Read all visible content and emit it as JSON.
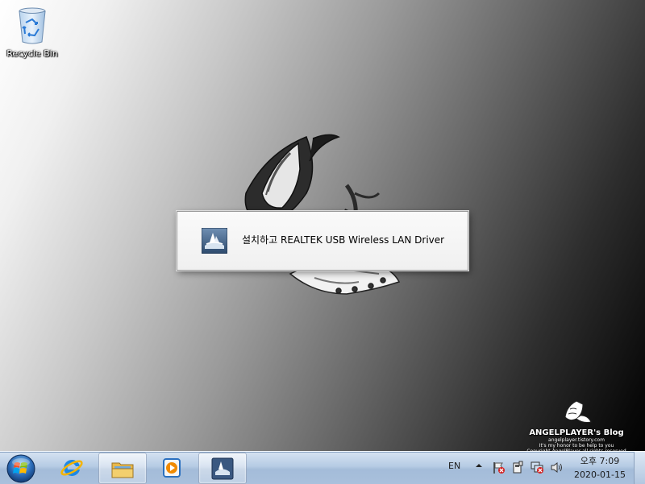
{
  "desktop": {
    "recycle_bin_label": "Recycle Bin"
  },
  "wallpaper": {
    "watermark_title": "ANGELPLAYER's Blog",
    "watermark_url": "angelplayer.tistory.com",
    "watermark_tagline": "It's my honor to be help to you",
    "watermark_copyright": "Copyright AngelPlayer all rights reserved"
  },
  "splash": {
    "message": "설치하고 REALTEK USB Wireless LAN Driver",
    "icon": "realtek-installer-icon"
  },
  "taskbar": {
    "start_icon": "windows-start-orb",
    "buttons": [
      {
        "icon": "internet-explorer-icon",
        "state": "pinned"
      },
      {
        "icon": "file-explorer-icon",
        "state": "running"
      },
      {
        "icon": "media-player-icon",
        "state": "pinned"
      },
      {
        "icon": "installer-app-icon",
        "state": "running"
      }
    ],
    "language": "EN",
    "tray_icons": [
      "action-center-flag-icon",
      "device-icon",
      "network-error-icon",
      "volume-icon"
    ],
    "clock_time": "오후 7:09",
    "clock_date": "2020-01-15"
  },
  "colors": {
    "taskbar_bg": "#b6cbe4",
    "dialog_bg": "#f0f0f0",
    "desktop_light": "#ffffff",
    "desktop_dark": "#000000"
  }
}
